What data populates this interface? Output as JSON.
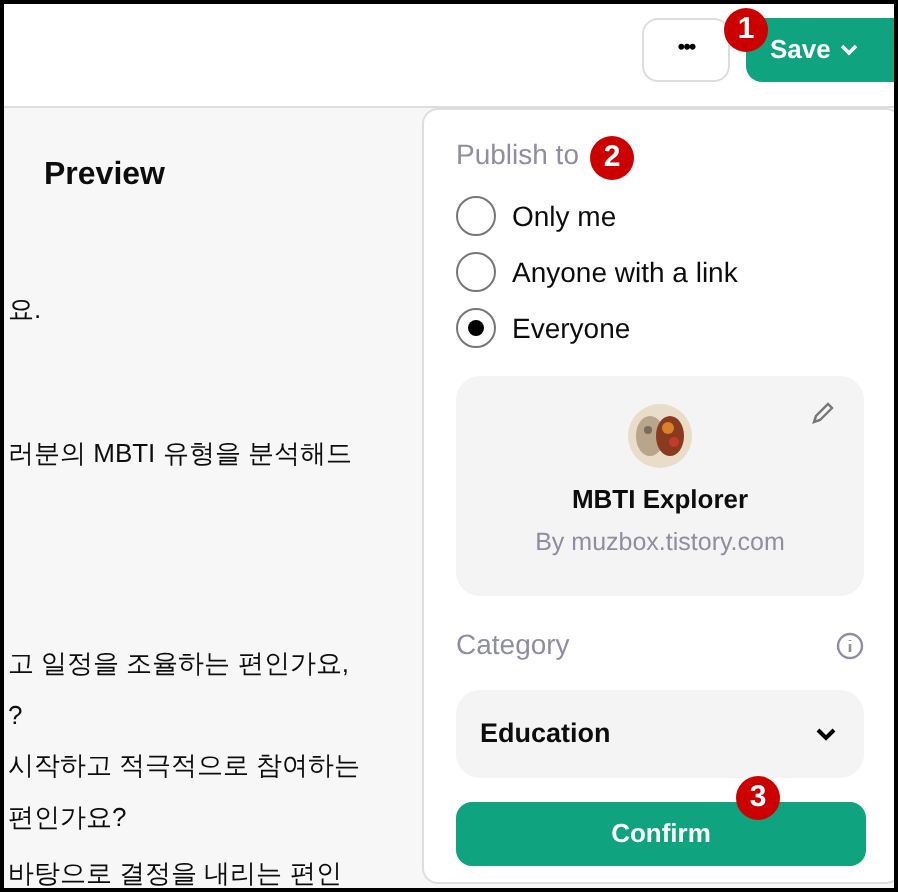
{
  "toolbar": {
    "more_button": "•••",
    "save_button": "Save"
  },
  "preview": {
    "title": "Preview",
    "lines": [
      "요.",
      "러분의 MBTI 유형을 분석해드",
      "고 일정을 조율하는 편인가요,",
      "?",
      "시작하고 적극적으로 참여하는",
      "편인가요?",
      "바탕으로 결정을 내리는 편인"
    ]
  },
  "publish": {
    "heading": "Publish to",
    "options": [
      {
        "label": "Only me",
        "selected": false
      },
      {
        "label": "Anyone with a link",
        "selected": false
      },
      {
        "label": "Everyone",
        "selected": true
      }
    ],
    "gpt": {
      "name": "MBTI Explorer",
      "author": "By muzbox.tistory.com"
    },
    "category_label": "Category",
    "category_value": "Education",
    "confirm_button": "Confirm"
  },
  "annotations": [
    "1",
    "2",
    "3"
  ]
}
